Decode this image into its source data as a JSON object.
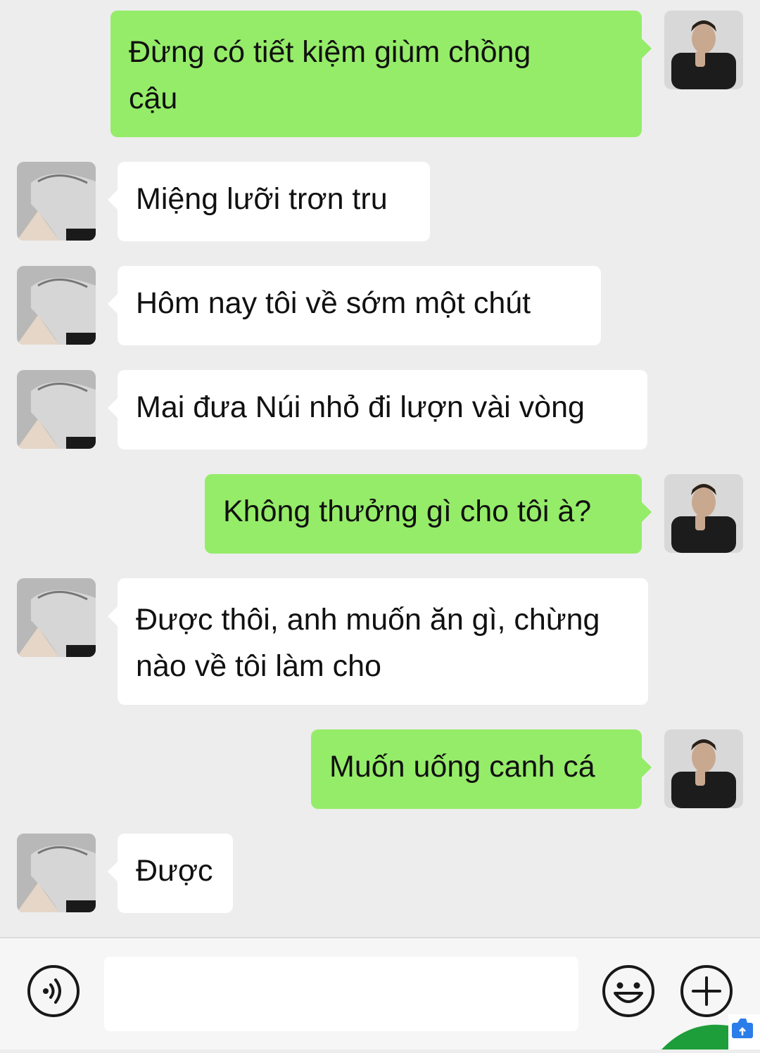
{
  "messages": [
    {
      "side": "out",
      "lines": [
        "Đừng có tiết kiệm giùm chồng",
        "cậu"
      ]
    },
    {
      "side": "in",
      "text": "Miệng lưỡi trơn tru"
    },
    {
      "side": "in",
      "text": "Hôm nay tôi về sớm một chút"
    },
    {
      "side": "in",
      "text": "Mai đưa Núi nhỏ đi lượn vài vòng"
    },
    {
      "side": "out",
      "text": "Không thưởng gì cho tôi à?"
    },
    {
      "side": "in",
      "lines": [
        "Được thôi, anh muốn ăn gì, chừng",
        "nào về tôi làm cho"
      ]
    },
    {
      "side": "out",
      "text": "Muốn uống canh cá"
    },
    {
      "side": "in",
      "text": "Được"
    }
  ],
  "input": {
    "placeholder": "",
    "value": ""
  },
  "icons": {
    "voice": "voice-icon",
    "emoji": "emoji-icon",
    "plus": "plus-icon"
  },
  "colors": {
    "background": "#ededed",
    "outgoing_bubble": "#95ec69",
    "incoming_bubble": "#ffffff"
  }
}
